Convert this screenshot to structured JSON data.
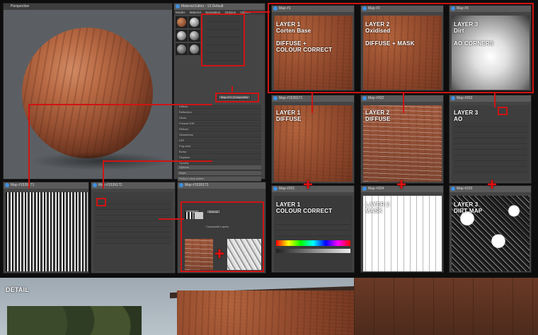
{
  "viewport": {
    "title": "Perspective"
  },
  "material_editor": {
    "title": "Material Editor - 13 Default",
    "menu": [
      "Modes",
      "Material",
      "Navigation",
      "Options",
      "Utilities"
    ],
    "map_button": "Map #11 (Composite)",
    "params": [
      "Diffuse",
      "Reflection",
      "Gloss",
      "Fresnel IOR",
      "Refract",
      "Glossiness",
      "IOR",
      "Fog color",
      "Bump",
      "Displace",
      "Opacity",
      "Environment"
    ],
    "rollouts": [
      "Options",
      "Maps",
      "Reflect interpolation"
    ]
  },
  "layers_top": [
    {
      "label": "LAYER 1\nCorten Base\n\nDIFFUSE +\nCOLOUR CORRECT",
      "title": "Map #1"
    },
    {
      "label": "LAYER 2\nOxidised\n\nDIFFUSE + MASK",
      "title": "Map #2"
    },
    {
      "label": "LAYER 3\nDirt\n\nAO CORNERS",
      "title": "Map #3"
    }
  ],
  "layers_mid": [
    {
      "label": "LAYER 1\nDIFFUSE",
      "title": "Map #1539171"
    },
    {
      "label": "LAYER 2\nDIFFUSE",
      "title": "Map #202"
    },
    {
      "label": "LAYER 3\nAO",
      "title": "Map #203"
    }
  ],
  "layers_bottom": [
    {
      "label": "LAYER 1\nCOLOUR CORRECT",
      "title": "Map #201"
    },
    {
      "label": "LAYER 2\nMASK",
      "title": "Map #204"
    },
    {
      "label": "LAYER 3\nDIRT MAP",
      "title": "Map #220"
    }
  ],
  "bottom_left": {
    "bitmap_title": "Map #1539171",
    "composite_title": "Map #1539172",
    "layers_title": "Map #1539173",
    "layer_label": "Layer 1",
    "mode_value": "Normal",
    "mask_title": "Composite Layers"
  },
  "detail": {
    "label": "DETAIL"
  },
  "colors": {
    "accent": "#d01414",
    "panel": "#444444"
  }
}
